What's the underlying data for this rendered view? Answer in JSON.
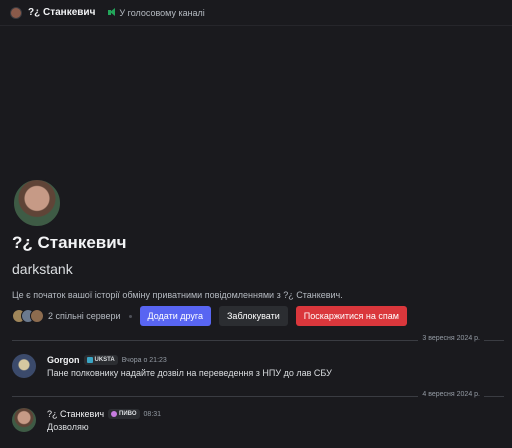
{
  "topbar": {
    "title": "?¿ Станкевич",
    "voice_status": "У голосовому каналі"
  },
  "profile": {
    "display_name": "?¿ Станкевич",
    "username": "darkstank",
    "intro": "Це є початок вашої історії обміну приватними повідомленнями з ?¿ Станкевич.",
    "mutual_servers": "2 спільні сервери",
    "add_friend": "Додати друга",
    "block": "Заблокувати",
    "report_spam": "Поскаржитися на спам"
  },
  "messages": [
    {
      "date_separator": "3 вересня 2024 р.",
      "author": "Gorgon",
      "tag": "UKSTA",
      "tag_color": "#3ba6c5",
      "time": "Вчора о 21:23",
      "text": "Пане полковнику надайте дозвіл на переведення з НПУ до лав СБУ"
    },
    {
      "date_separator": "4 вересня 2024 р.",
      "author": "?¿ Станкевич",
      "tag": "ПИВО",
      "tag_color": "#c77de0",
      "time": "08:31",
      "text": "Дозволяю"
    }
  ],
  "colors": {
    "background": "#1a1a1e",
    "primary_button": "#5865f2",
    "danger_button": "#da373c",
    "secondary_button": "#2b2d31"
  }
}
